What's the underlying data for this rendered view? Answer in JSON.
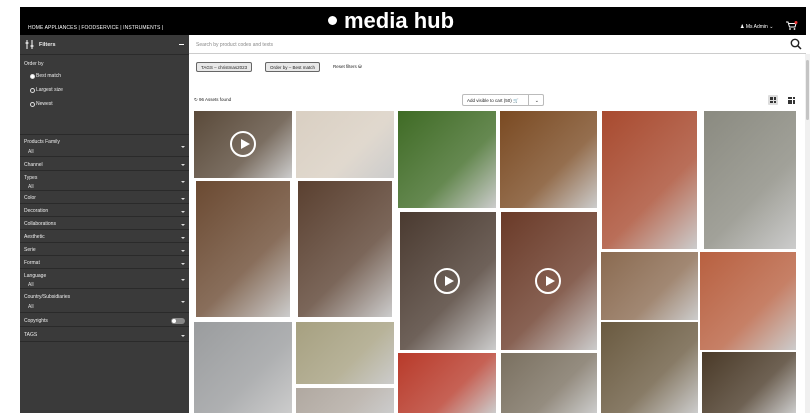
{
  "header": {
    "nav": "HOME APPLIANCES | FOODSERVICE | INSTRUMENTS |",
    "brand": "media hub",
    "user": "Ms Admin"
  },
  "sidebar": {
    "title": "Filters",
    "order_by": {
      "label": "Order by",
      "options": [
        "Best match",
        "Largest size",
        "Newest"
      ],
      "selected": "Best match"
    },
    "sections": [
      {
        "label": "Products Family",
        "value": "All"
      },
      {
        "label": "Channel"
      },
      {
        "label": "Types",
        "value": "All"
      },
      {
        "label": "Color"
      },
      {
        "label": "Decoration"
      },
      {
        "label": "Collaborations"
      },
      {
        "label": "Aesthetic"
      },
      {
        "label": "Serie"
      },
      {
        "label": "Format"
      },
      {
        "label": "Language",
        "value": "All"
      },
      {
        "label": "Country/Subsidiaries",
        "value": "All"
      },
      {
        "label": "Copyrights"
      },
      {
        "label": "TAGS"
      }
    ]
  },
  "search": {
    "placeholder": "Search by product codes and texts"
  },
  "chips": [
    "TAGS – christmas2023",
    "Order by – Best match"
  ],
  "reset_label": "Reset filters",
  "assets_count": "96 Assets found",
  "add_to_cart": "Add visible to cart (50)",
  "media": [
    {
      "name": "chef cooking in kitchen",
      "video": true,
      "color": "#5a4a3a"
    },
    {
      "name": "living room with christmas tree",
      "color": "#d9cfc2"
    },
    {
      "name": "fresh basil and tomatoes",
      "color": "#3f6b25"
    },
    {
      "name": "spiced dish in bowls",
      "color": "#7a4a22"
    },
    {
      "name": "stuffed tomatoes on tray",
      "color": "#a84a2f"
    },
    {
      "name": "salad in bowl on counter",
      "color": "#8a8a80"
    },
    {
      "name": "coffee dessert in glass",
      "color": "#6b4a32"
    },
    {
      "name": "cake slices with strawberries",
      "color": "#5a4030"
    },
    {
      "name": "baking bread with hands",
      "video": true,
      "color": "#4a3a30"
    },
    {
      "name": "child cooking with mixing bowl",
      "video": true,
      "color": "#6a3a28"
    },
    {
      "name": "salad plate",
      "color": "#8a6a50"
    },
    {
      "name": "grilled salmon with herbs",
      "color": "#b86040"
    },
    {
      "name": "modern kitchen interior",
      "color": "#9a9c9e"
    },
    {
      "name": "tea press with lemons",
      "color": "#a6a080"
    },
    {
      "name": "tomatoes and mushrooms",
      "color": "#b83a2a"
    },
    {
      "name": "dining room interior",
      "color": "#7a7060"
    },
    {
      "name": "salad on wooden board",
      "color": "#6a5a40"
    },
    {
      "name": "candlelit dinner table",
      "color": "#4a3a28"
    },
    {
      "name": "person in knit sweater",
      "color": "#b0a8a0"
    },
    {
      "name": "dark kitchen tile",
      "color": "#3a2f2a"
    }
  ]
}
